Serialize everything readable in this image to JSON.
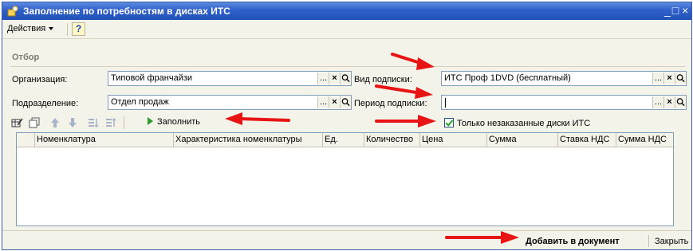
{
  "window": {
    "title": "Заполнение по потребностям в дисках ИТС",
    "minimize_glyph": "_",
    "close_glyph": "□ ×"
  },
  "menubar": {
    "actions_label": "Действия",
    "help_label": "?"
  },
  "filter": {
    "group_label": "Отбор",
    "organization": {
      "label": "Организация:",
      "value": "Типовой франчайзи"
    },
    "department": {
      "label": "Подразделение:",
      "value": "Отдел продаж"
    },
    "subscription_type": {
      "label": "Вид подписки:",
      "value": "ИТС Проф 1DVD (бесплатный)"
    },
    "subscription_period": {
      "label": "Период подписки:",
      "value": ""
    },
    "field_buttons": {
      "select": "...",
      "clear": "×",
      "open": "🔍"
    }
  },
  "toolbar": {
    "fill_label": "Заполнить",
    "only_unordered_label": "Только незаказанные диски ИТС",
    "only_unordered_checked": true
  },
  "table": {
    "columns": [
      "Номенклатура",
      "Характеристика номенклатуры",
      "Ед.",
      "Количество",
      "Цена",
      "Сумма",
      "Ставка НДС",
      "Сумма НДС"
    ]
  },
  "footer": {
    "add_label": "Добавить в документ",
    "close_label": "Закрыть"
  },
  "colors": {
    "title_bar": "#2f5fc8",
    "annotation_arrow": "#e81414",
    "fill_icon": "#2c9a2c"
  }
}
